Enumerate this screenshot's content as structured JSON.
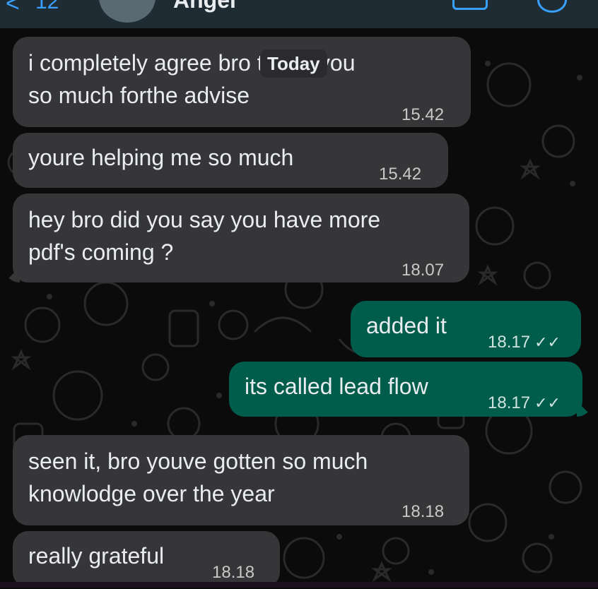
{
  "header": {
    "back_glyph": "<",
    "unread_count": "12",
    "contact_name": "Angel"
  },
  "date_chip": "Today",
  "messages": [
    {
      "text_lines": [
        "i completely agree bro thank you",
        "so much forthe advise"
      ],
      "time": "15.42",
      "direction": "in"
    },
    {
      "text_lines": [
        "youre helping me so much"
      ],
      "time": "15.42",
      "direction": "in"
    },
    {
      "text_lines": [
        "hey bro did you say you have more",
        "pdf's coming ?"
      ],
      "time": "18.07",
      "direction": "in"
    },
    {
      "text_lines": [
        "added it"
      ],
      "time": "18.17",
      "direction": "out",
      "status": "read"
    },
    {
      "text_lines": [
        "its called lead flow"
      ],
      "time": "18.17",
      "direction": "out",
      "status": "read"
    },
    {
      "text_lines": [
        "seen it, bro youve gotten so much",
        "knowlodge over the year"
      ],
      "time": "18.18",
      "direction": "in"
    },
    {
      "text_lines": [
        "really grateful"
      ],
      "time": "18.18",
      "direction": "in"
    }
  ],
  "colors": {
    "incoming_bubble": "#363638",
    "outgoing_bubble": "#005c4b",
    "background": "#0b0b0b",
    "accent": "#3aa0ff"
  },
  "icons": [
    "back-chevron-icon",
    "video-call-icon",
    "voice-call-icon",
    "double-check-icon"
  ]
}
